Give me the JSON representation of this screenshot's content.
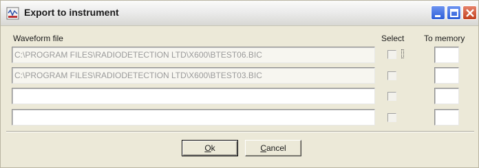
{
  "window": {
    "title": "Export to instrument"
  },
  "headers": {
    "waveform": "Waveform file",
    "select": "Select",
    "memory": "To memory"
  },
  "rows": [
    {
      "file": "C:\\PROGRAM FILES\\RADIODETECTION LTD\\X600\\BTEST06.BIC",
      "selected": false,
      "memory": ""
    },
    {
      "file": "C:\\PROGRAM FILES\\RADIODETECTION LTD\\X600\\BTEST03.BIC",
      "selected": false,
      "memory": ""
    },
    {
      "file": "",
      "selected": false,
      "memory": ""
    },
    {
      "file": "",
      "selected": false,
      "memory": ""
    }
  ],
  "buttons": {
    "ok_mnemonic": "O",
    "ok_rest": "k",
    "cancel_mnemonic": "C",
    "cancel_rest": "ancel"
  },
  "colors": {
    "title_min_max": "#2c5ed8",
    "title_close": "#c1401e",
    "dialog_bg": "#ece9d8"
  }
}
